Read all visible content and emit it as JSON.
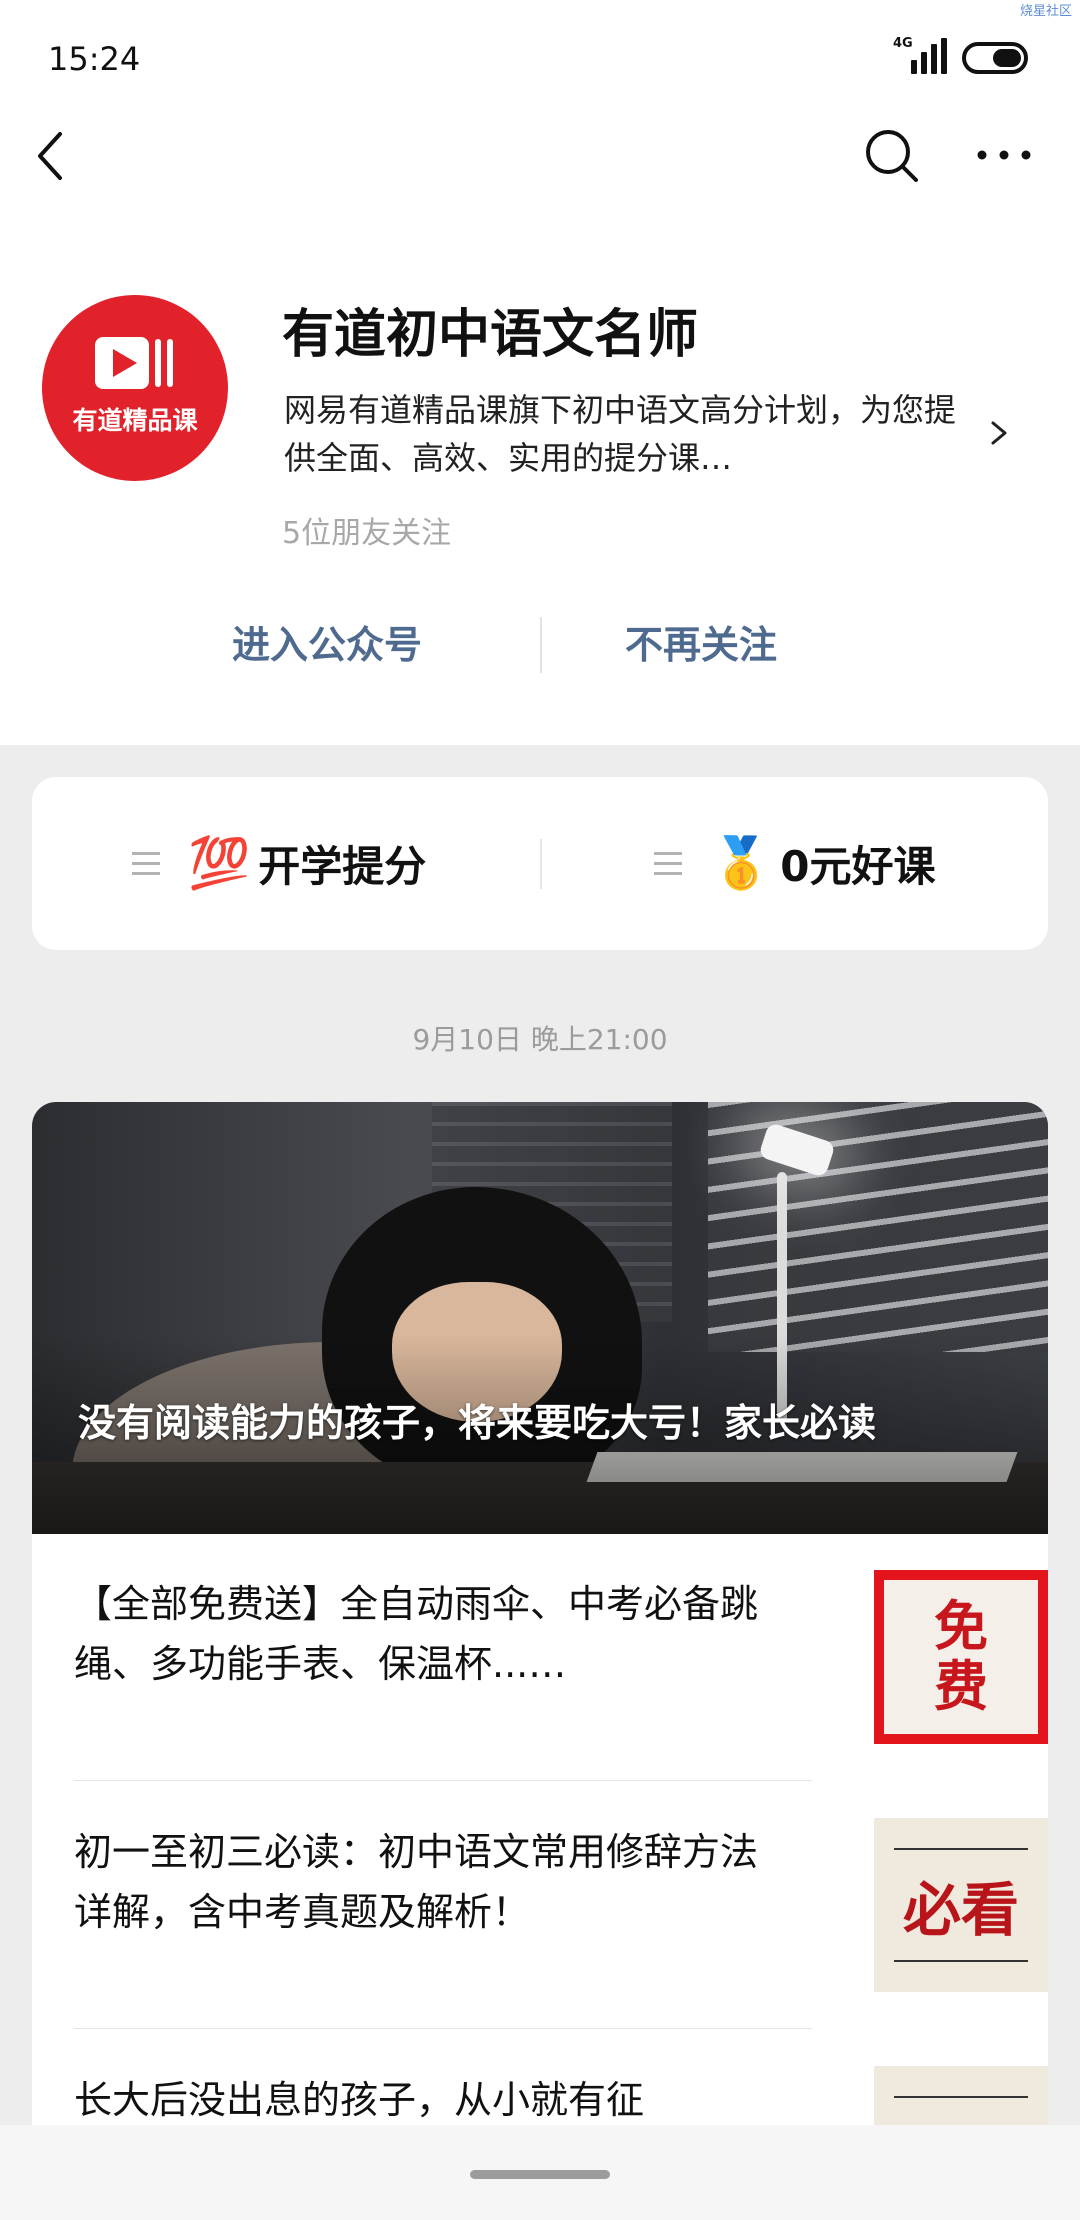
{
  "status_bar": {
    "time": "15:24",
    "network": "4G",
    "watermark": "烧星社区"
  },
  "nav": {
    "back_icon": "chevron-left-icon",
    "search_icon": "search-icon",
    "more_icon": "more-horizontal-icon"
  },
  "account": {
    "avatar_text": "有道精品课",
    "name": "有道初中语文名师",
    "description": "网易有道精品课旗下初中语文高分计划，为您提供全面、高效、实用的提分课…",
    "followers": "5位朋友关注",
    "enter_label": "进入公众号",
    "unfollow_label": "不再关注"
  },
  "menu": {
    "items": [
      {
        "emoji": "💯",
        "label": "开学提分"
      },
      {
        "emoji": "🥇",
        "label": "0元好课"
      }
    ]
  },
  "feed": {
    "date": "9月10日 晚上21:00",
    "hero_title": "没有阅读能力的孩子，将来要吃大亏！家长必读",
    "items": [
      {
        "title": "【全部免费送】全自动雨伞、中考必备跳绳、多功能手表、保温杯...…",
        "thumb_text_1": "免",
        "thumb_text_2": "费"
      },
      {
        "title": "初一至初三必读：初中语文常用修辞方法详解，含中考真题及解析！",
        "thumb_text": "必看"
      },
      {
        "title": "长大后没出息的孩子，从小就有征"
      }
    ]
  },
  "colors": {
    "accent_red": "#e2222b",
    "link_blue": "#4f6a8f",
    "page_bg": "#ededed"
  }
}
